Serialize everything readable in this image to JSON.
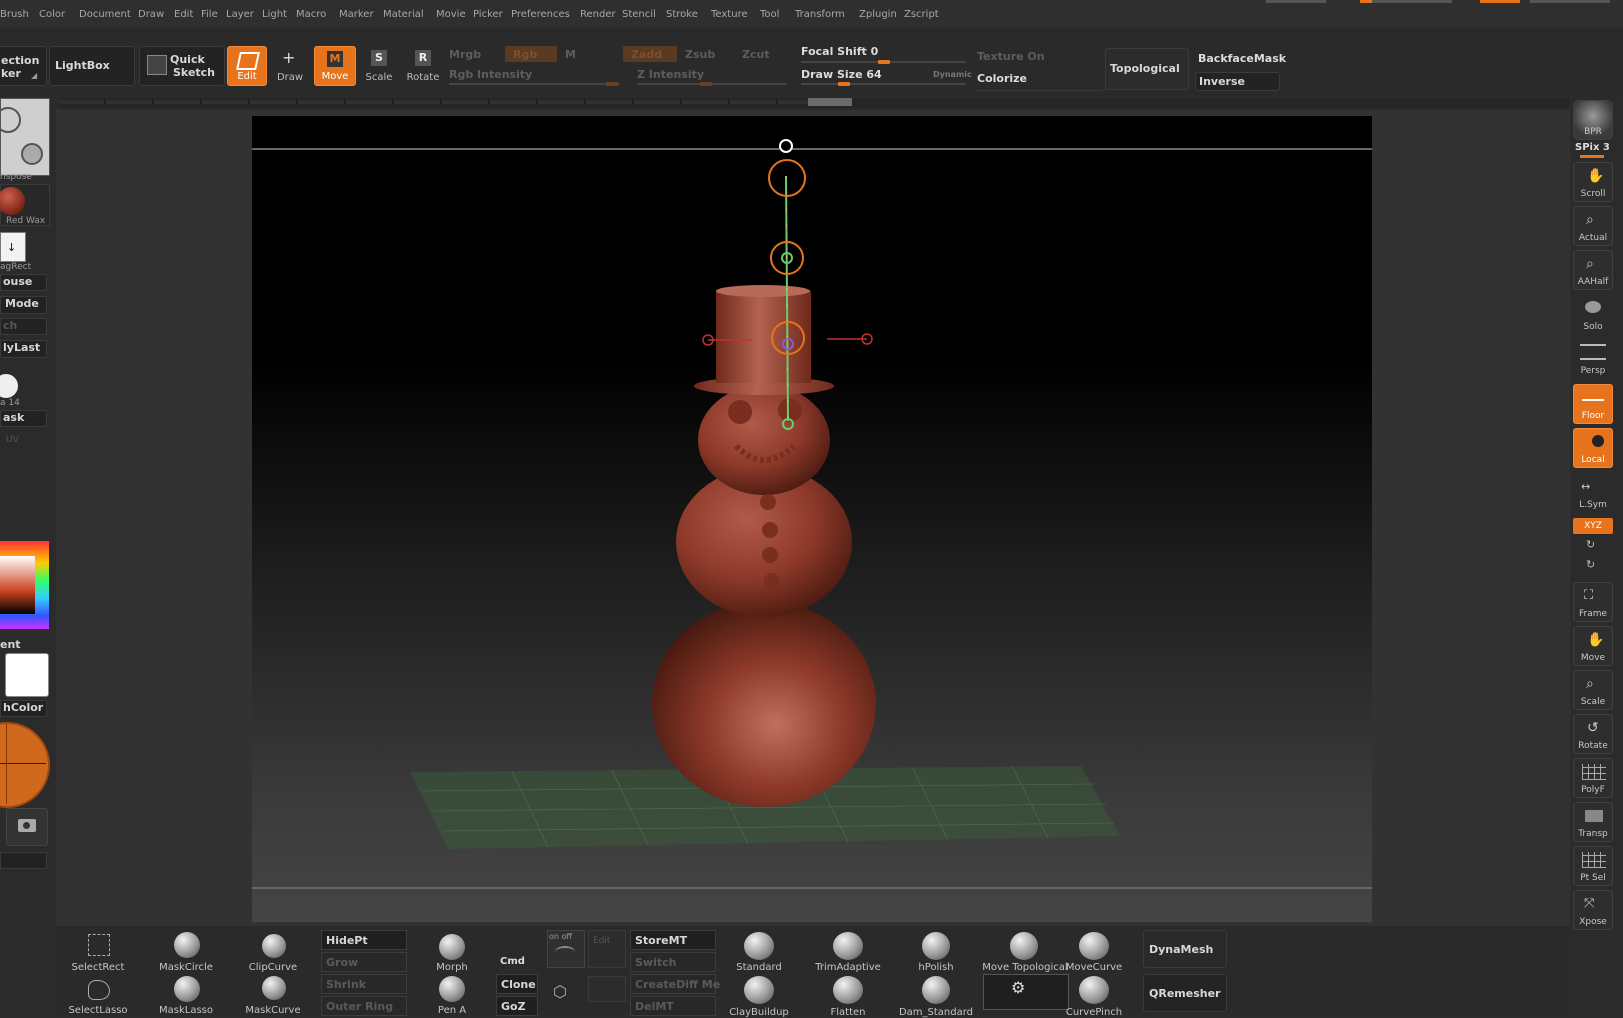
{
  "menu": [
    "Brush",
    "Color",
    "Document",
    "Draw",
    "Edit",
    "File",
    "Layer",
    "Light",
    "Macro",
    "Marker",
    "Material",
    "Movie",
    "Picker",
    "Preferences",
    "Render",
    "Stencil",
    "Stroke",
    "Texture",
    "Tool",
    "Transform",
    "Zplugin",
    "Zscript"
  ],
  "top_shelf": {
    "selection_label_1": "ection",
    "selection_label_2": "ker",
    "lightbox": "LightBox",
    "quick_sketch_1": "Quick",
    "quick_sketch_2": "Sketch",
    "edit": "Edit",
    "draw": "Draw",
    "move": "Move",
    "move_key": "M",
    "scale": "Scale",
    "scale_key": "S",
    "rotate": "Rotate",
    "rotate_key": "R",
    "mrgb": "Mrgb",
    "rgb": "Rgb",
    "m": "M",
    "rgb_intensity": "Rgb Intensity",
    "zadd": "Zadd",
    "zsub": "Zsub",
    "zcut": "Zcut",
    "z_intensity": "Z Intensity",
    "focal_shift": "Focal Shift 0",
    "draw_size": "Draw Size 64",
    "dynamic": "Dynamic",
    "texture_on": "Texture On",
    "colorize": "Colorize",
    "topological": "Topological",
    "backface_mask": "BackfaceMask",
    "inverse": "Inverse"
  },
  "left_panel": {
    "transpose": "nspose",
    "material": "Red Wax",
    "stroke": "agRect",
    "alpha_label": "ouse",
    "mode": "Mode",
    "ch": "ch",
    "lylast": "lyLast",
    "alpha_14": "a 14",
    "mask": "ask",
    "uv": "UV",
    "gradient": "ent",
    "switch_color": "hColor"
  },
  "right_panel": [
    {
      "id": "bpr",
      "label": "BPR"
    },
    {
      "id": "spix",
      "label": "SPix 3"
    },
    {
      "id": "scroll",
      "label": "Scroll"
    },
    {
      "id": "actual",
      "label": "Actual"
    },
    {
      "id": "aahalf",
      "label": "AAHalf"
    },
    {
      "id": "solo",
      "label": "Solo"
    },
    {
      "id": "persp",
      "label": "Persp"
    },
    {
      "id": "floor",
      "label": "Floor"
    },
    {
      "id": "local",
      "label": "Local"
    },
    {
      "id": "lsym",
      "label": "L.Sym"
    },
    {
      "id": "xyz",
      "label": "XYZ"
    },
    {
      "id": "frame",
      "label": "Frame"
    },
    {
      "id": "move",
      "label": "Move"
    },
    {
      "id": "scale",
      "label": "Scale"
    },
    {
      "id": "rotate",
      "label": "Rotate"
    },
    {
      "id": "polyf",
      "label": "PolyF"
    },
    {
      "id": "transp",
      "label": "Transp"
    },
    {
      "id": "ptsel",
      "label": "Pt Sel"
    },
    {
      "id": "xpose",
      "label": "Xpose"
    }
  ],
  "bottom_shelf": {
    "selectrect": "SelectRect",
    "selectlasso": "SelectLasso",
    "maskcircle": "MaskCircle",
    "masklasso": "MaskLasso",
    "clipcurve": "ClipCurve",
    "maskcurve": "MaskCurve",
    "hidept": "HidePt",
    "grow": "Grow",
    "shrink": "Shrink",
    "outer_ring": "Outer Ring",
    "morph": "Morph",
    "pen_a": "Pen A",
    "cmd": "Cmd",
    "clone": "Clone",
    "goz": "GoZ",
    "on_off": "on off",
    "edit": "Edit",
    "storemt": "StoreMT",
    "switch": "Switch",
    "creatediff": "CreateDiff Me",
    "delmt": "DelMT",
    "standard": "Standard",
    "claybuildup": "ClayBuildup",
    "trimadaptive": "TrimAdaptive",
    "flatten": "Flatten",
    "hpolish": "hPolish",
    "dam_standard": "Dam_Standard",
    "move_topological": "Move Topological",
    "movecurve": "MoveCurve",
    "curvepinch": "CurvePinch",
    "dynamesh": "DynaMesh",
    "qremesher": "QRemesher"
  },
  "colors": {
    "accent": "#e7741c",
    "model": "#8e3a2a",
    "background": "#2b2b2b"
  }
}
